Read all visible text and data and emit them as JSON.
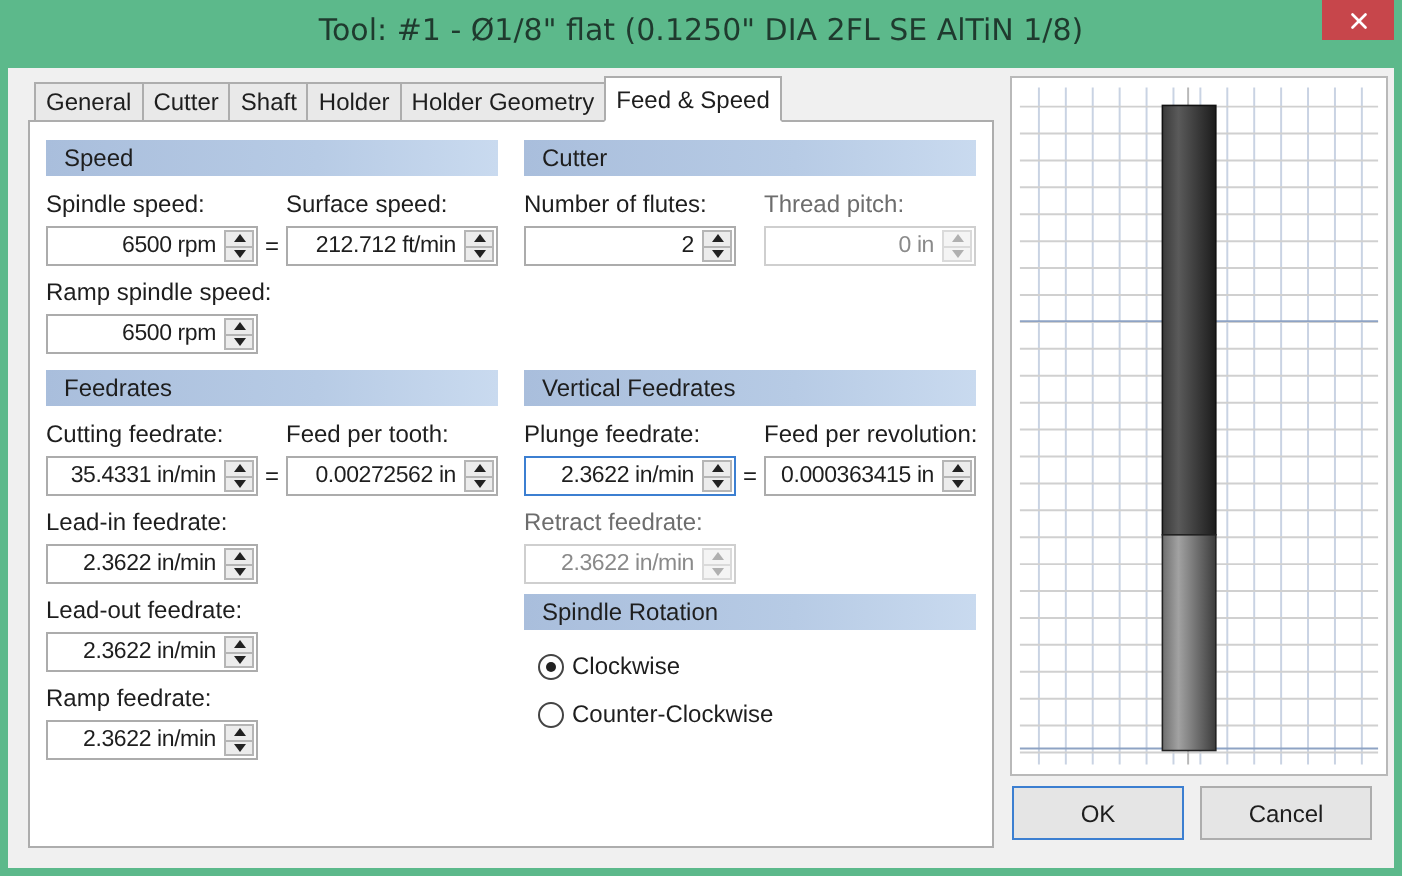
{
  "window": {
    "title": "Tool: #1 - Ø1/8\" flat (0.1250\" DIA 2FL SE AlTiN 1/8)"
  },
  "tabs": [
    {
      "label": "General",
      "selected": false
    },
    {
      "label": "Cutter",
      "selected": false
    },
    {
      "label": "Shaft",
      "selected": false
    },
    {
      "label": "Holder",
      "selected": false
    },
    {
      "label": "Holder Geometry",
      "selected": false
    },
    {
      "label": "Feed & Speed",
      "selected": true
    }
  ],
  "columns": [
    {
      "sections": [
        {
          "title": "Speed",
          "kind": "fields",
          "rows": [
            {
              "separator": "=",
              "fields": [
                {
                  "label": "Spindle speed:",
                  "value": "6500 rpm",
                  "disabled": false,
                  "focused": false
                },
                {
                  "label": "Surface speed:",
                  "value": "212.712 ft/min",
                  "disabled": false,
                  "focused": false
                }
              ]
            },
            {
              "fields": [
                {
                  "label": "Ramp spindle speed:",
                  "value": "6500 rpm",
                  "disabled": false,
                  "focused": false
                }
              ]
            }
          ]
        },
        {
          "title": "Feedrates",
          "kind": "fields",
          "rows": [
            {
              "separator": "=",
              "fields": [
                {
                  "label": "Cutting feedrate:",
                  "value": "35.4331 in/min",
                  "disabled": false,
                  "focused": false
                },
                {
                  "label": "Feed per tooth:",
                  "value": "0.00272562 in",
                  "disabled": false,
                  "focused": false
                }
              ]
            },
            {
              "fields": [
                {
                  "label": "Lead-in feedrate:",
                  "value": "2.3622 in/min",
                  "disabled": false,
                  "focused": false
                }
              ]
            },
            {
              "fields": [
                {
                  "label": "Lead-out feedrate:",
                  "value": "2.3622 in/min",
                  "disabled": false,
                  "focused": false
                }
              ]
            },
            {
              "fields": [
                {
                  "label": "Ramp feedrate:",
                  "value": "2.3622 in/min",
                  "disabled": false,
                  "focused": false
                }
              ]
            }
          ]
        }
      ]
    },
    {
      "sections": [
        {
          "title": "Cutter",
          "kind": "fields",
          "rows": [
            {
              "fields": [
                {
                  "label": "Number of flutes:",
                  "value": "2",
                  "disabled": false,
                  "focused": false
                },
                {
                  "label": "Thread pitch:",
                  "value": "0 in",
                  "disabled": true,
                  "focused": false
                }
              ]
            }
          ]
        },
        {
          "title": "Vertical Feedrates",
          "kind": "fields",
          "rows": [
            {
              "separator": "=",
              "fields": [
                {
                  "label": "Plunge feedrate:",
                  "value": "2.3622 in/min",
                  "disabled": false,
                  "focused": true
                },
                {
                  "label": "Feed per revolution:",
                  "value": "0.000363415 in",
                  "disabled": false,
                  "focused": false
                }
              ]
            },
            {
              "fields": [
                {
                  "label": "Retract feedrate:",
                  "value": "2.3622 in/min",
                  "disabled": true,
                  "focused": false
                }
              ]
            }
          ]
        },
        {
          "title": "Spindle Rotation",
          "kind": "radios",
          "options": [
            {
              "label": "Clockwise",
              "selected": true
            },
            {
              "label": "Counter-Clockwise",
              "selected": false
            }
          ]
        }
      ]
    }
  ],
  "buttons": [
    {
      "label": "OK",
      "default": true
    },
    {
      "label": "Cancel",
      "default": false
    }
  ]
}
